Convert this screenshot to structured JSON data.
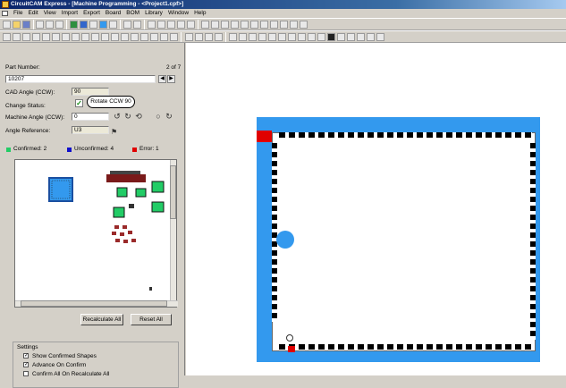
{
  "window": {
    "title": "CircuitCAM Express - [Machine Programming - <Project1.cpf>]"
  },
  "menu": [
    "File",
    "Edit",
    "View",
    "Import",
    "Export",
    "Board",
    "BOM",
    "Library",
    "Window",
    "Help"
  ],
  "panel": {
    "part_number_label": "Part Number:",
    "part_count": "2 of 7",
    "part_number_value": "10207",
    "cad_angle_label": "CAD Angle (CCW):",
    "cad_angle_value": "90",
    "change_status_label": "Change Status:",
    "rotate_tooltip": "Rotate CCW 90",
    "machine_angle_label": "Machine Angle (CCW):",
    "machine_angle_value": "0",
    "angle_reference_label": "Angle Reference:",
    "angle_reference_value": "U3",
    "confirmed_label": "Confirmed: 2",
    "unconfirmed_label": "Unconfirmed: 4",
    "error_label": "Error: 1",
    "recalculate_label": "Recalculate All",
    "reset_label": "Reset All"
  },
  "settings": {
    "title": "Settings",
    "items": [
      {
        "label": "Show Confirmed Shapes",
        "checked": true
      },
      {
        "label": "Advance On Confirm",
        "checked": true
      },
      {
        "label": "Confirm All On Recalculate All",
        "checked": false
      }
    ]
  },
  "colors": {
    "confirmed": "#22cc66",
    "unconfirmed": "#1010cc",
    "error": "#e00000",
    "pad_blue": "#3399ee"
  },
  "icons": [
    "check-icon",
    "rotate-ccw-icon",
    "rotate-cw-icon",
    "flash-icon",
    "rotate-arrow-icon"
  ]
}
